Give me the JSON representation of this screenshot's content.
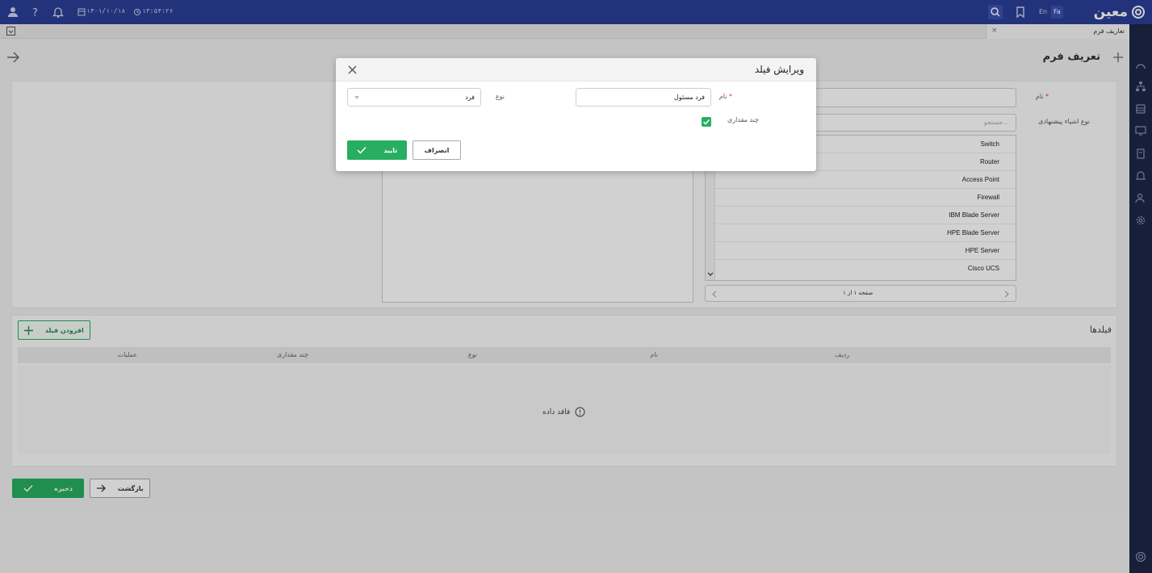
{
  "topbar": {
    "date": "۱۴۰۱/۱۰/۱۸",
    "time": "۱۳:۵۴:۲۶",
    "lang_en": "En",
    "lang_fa": "Fa",
    "logo_text": "معین"
  },
  "tab": {
    "label": "تعاریف فرم",
    "close": "×"
  },
  "page": {
    "title": "تعریف فرم",
    "name_label": "نام",
    "types_label": "نوع اشیاء پیشنهادی",
    "search_placeholder": "جستجو...",
    "object_types": [
      "Switch",
      "Router",
      "Access Point",
      "Firewall",
      "IBM Blade Server",
      "HPE Blade Server",
      "HPE Server",
      "Cisco UCS"
    ],
    "pager_text": "صفحه ۱ از ۱"
  },
  "fields": {
    "title": "فیلدها",
    "add_button": "افزودن فیلد",
    "columns": [
      "ردیف",
      "نام",
      "نوع",
      "چند مقداری",
      "عملیات"
    ],
    "empty_text": "فاقد داده"
  },
  "footer": {
    "save": "ذخیره",
    "back": "بازگشت"
  },
  "dialog": {
    "title": "ویرایش فیلد",
    "name_label": "نام",
    "name_value": "فرد مسئول",
    "type_label": "نوع",
    "type_value": "فرد",
    "multi_label": "چند مقداری",
    "multi_checked": true,
    "confirm": "تایید",
    "cancel": "انصراف"
  },
  "colors": {
    "brand": "#2b3f97",
    "accent": "#27ae60",
    "rail": "#1e2745"
  }
}
